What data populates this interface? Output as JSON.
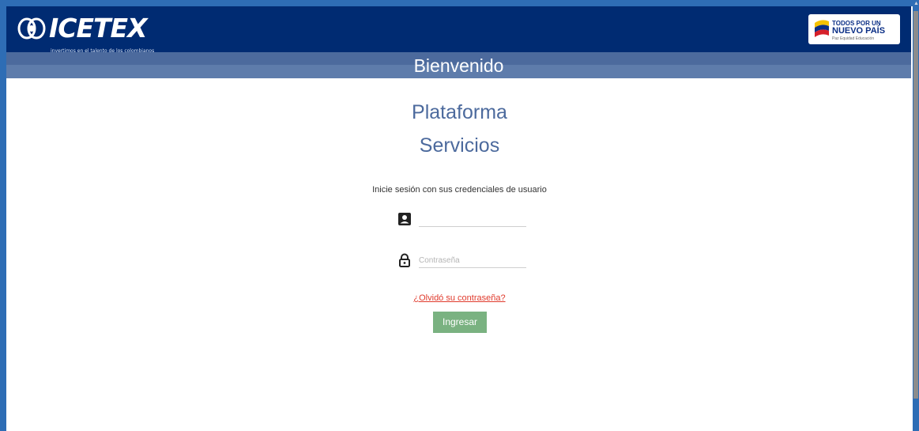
{
  "header": {
    "logo_text": "ICETEX",
    "logo_tagline": "invertimos en el talento de los colombianos",
    "gov_logo": {
      "line1": "TODOS POR UN",
      "line2": "NUEVO PAÍS",
      "line3": "Paz   Equidad   Educación"
    }
  },
  "welcome": {
    "title": "Bienvenido"
  },
  "main": {
    "heading_line1": "Plataforma",
    "heading_line2": "Servicios",
    "instruction": "Inicie sesión con sus credenciales de usuario",
    "username": {
      "value": "",
      "placeholder": "",
      "icon": "user-card-icon"
    },
    "password": {
      "value": "",
      "placeholder": "Contraseña",
      "icon": "padlock-icon"
    },
    "forgot_link": "¿Olvidó su contraseña?",
    "submit_label": "Ingresar"
  },
  "colors": {
    "header_bg": "#002b72",
    "welcome_bg": "#4c6a9d",
    "heading": "#4c6a9d",
    "link": "#e03a2c",
    "button": "#7ab281",
    "frame": "#2e6db5"
  }
}
